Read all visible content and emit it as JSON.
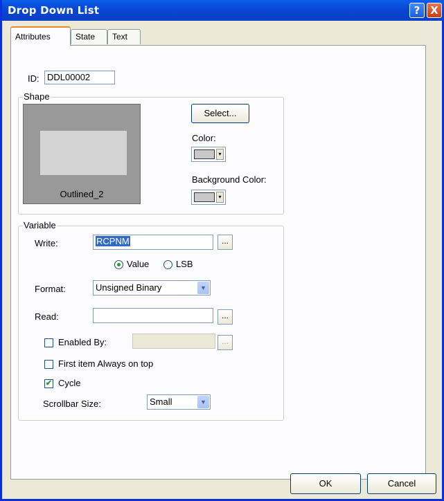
{
  "window": {
    "title": "Drop Down List",
    "help_label": "?",
    "close_label": "X"
  },
  "tabs": [
    {
      "label": "Attributes"
    },
    {
      "label": "State"
    },
    {
      "label": "Text"
    }
  ],
  "id_field": {
    "label": "ID:",
    "value": "DDL00002"
  },
  "shape": {
    "group_title": "Shape",
    "preview_caption": "Outlined_2",
    "select_button": "Select...",
    "color_label": "Color:",
    "background_color_label": "Background Color:",
    "swatch_arrow": "▾"
  },
  "variable": {
    "group_title": "Variable",
    "write_label": "Write:",
    "write_value": "RCPNM",
    "browse": "...",
    "value_option": "Value",
    "lsb_option": "LSB",
    "format_label": "Format:",
    "format_value": "Unsigned Binary",
    "read_label": "Read:",
    "read_value": "",
    "enabled_by_label": "Enabled By:",
    "enabled_by_value": "",
    "first_item_label": "First item Always on top",
    "cycle_label": "Cycle",
    "cycle_check": "✔",
    "scrollbar_label": "Scrollbar Size:",
    "scrollbar_value": "Small",
    "combo_arrow": "▼"
  },
  "buttons": {
    "ok": "OK",
    "cancel": "Cancel"
  },
  "colors": {
    "title_bar": "#0846d4",
    "window_bg": "#ece9d8",
    "shape_color": "#c8c8c8"
  }
}
